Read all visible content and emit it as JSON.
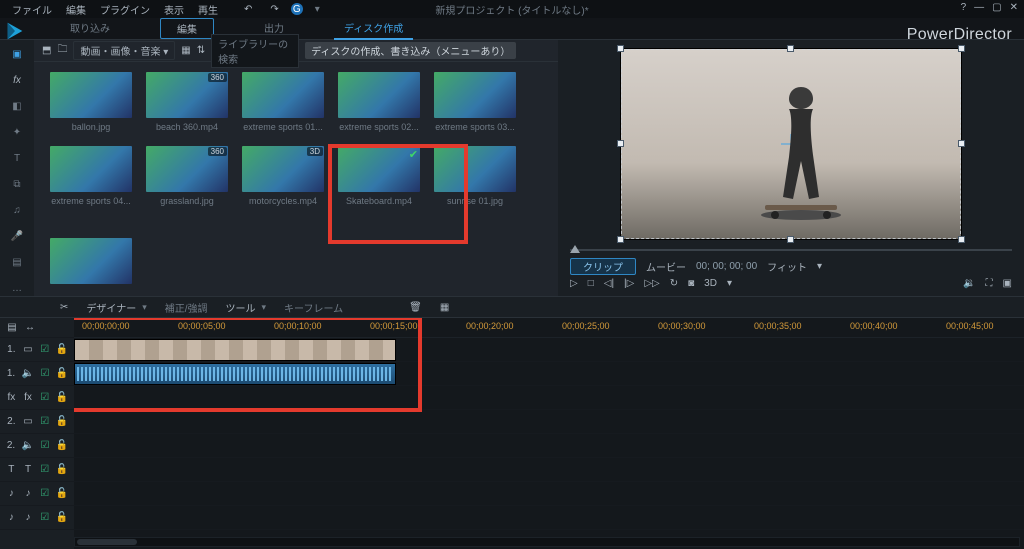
{
  "menu": {
    "file": "ファイル",
    "edit": "編集",
    "plugin": "プラグイン",
    "view": "表示",
    "play": "再生"
  },
  "title_center": "新規プロジェクト (タイトルなし)*",
  "brand": "PowerDirector",
  "tabs": {
    "import": "取り込み",
    "edit": "編集",
    "output": "出力",
    "disc": "ディスク作成"
  },
  "mediaTools": {
    "dropdown": "動画・画像・音楽",
    "search_ph": "ライブラリーの検索",
    "pill": "ディスクの作成、書き込み（メニューあり）"
  },
  "thumbs": [
    {
      "nm": "ballon.jpg",
      "cls": "p-ballon",
      "badge": ""
    },
    {
      "nm": "beach 360.mp4",
      "cls": "p-beach",
      "badge": "360"
    },
    {
      "nm": "extreme sports 01...",
      "cls": "p-ex1",
      "badge": ""
    },
    {
      "nm": "extreme sports 02...",
      "cls": "p-ex2",
      "badge": ""
    },
    {
      "nm": "extreme sports 03...",
      "cls": "p-ex3",
      "badge": ""
    },
    {
      "nm": "extreme sports 04...",
      "cls": "p-ex4",
      "badge": ""
    },
    {
      "nm": "grassland.jpg",
      "cls": "p-grass",
      "badge": "360"
    },
    {
      "nm": "motorcycles.mp4",
      "cls": "p-moto",
      "badge": "3D"
    },
    {
      "nm": "Skateboard.mp4",
      "cls": "p-skate",
      "badge": "",
      "sel": true
    },
    {
      "nm": "sunrise 01.jpg",
      "cls": "p-sun",
      "badge": ""
    }
  ],
  "extra_thumb": {
    "nm": "",
    "cls": "p-sky"
  },
  "preview": {
    "clip_pill": "クリップ",
    "movie": "ムービー",
    "timecode": "00; 00; 00; 00",
    "fit": "フィット",
    "three_d": "3D"
  },
  "mid": {
    "designer": "デザイナー",
    "fix": "補正/強調",
    "tool": "ツール",
    "keyframe": "キーフレーム"
  },
  "ruler": [
    "00;00;00;00",
    "00;00;05;00",
    "00;00;10;00",
    "00;00;15;00",
    "00;00;20;00",
    "00;00;25;00",
    "00;00;30;00",
    "00;00;35;00",
    "00;00;40;00",
    "00;00;45;00"
  ],
  "track_labels": [
    "1.",
    "1.",
    "fx",
    "2.",
    "2.",
    "T",
    "♪",
    "♪"
  ]
}
